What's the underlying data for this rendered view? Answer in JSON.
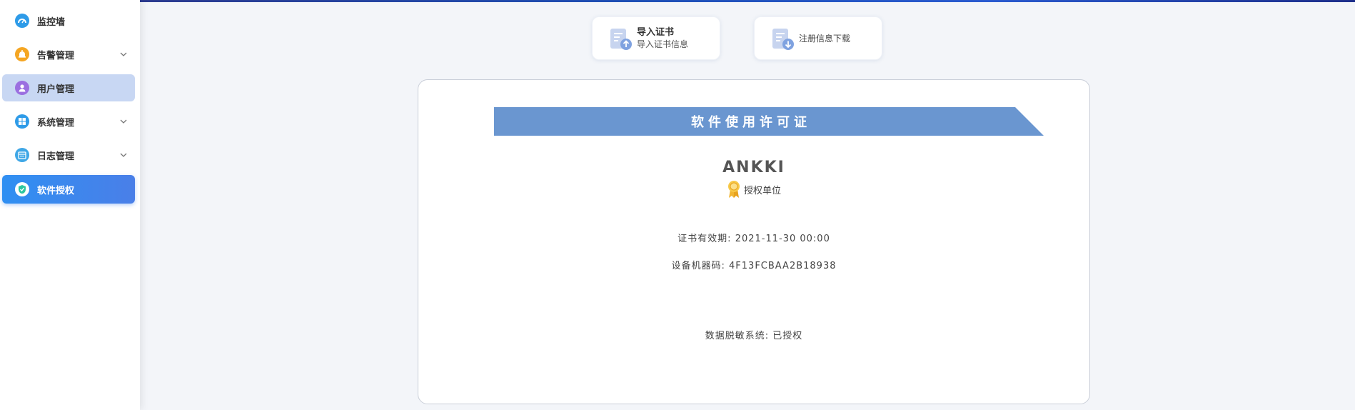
{
  "sidebar": {
    "items": [
      {
        "label": "监控墙",
        "icon": "dashboard-gauge-icon",
        "color": "#2e9be8"
      },
      {
        "label": "告警管理",
        "icon": "alarm-bell-icon",
        "color": "#f5a623"
      },
      {
        "label": "用户管理",
        "icon": "user-icon",
        "color": "#9b6fe0"
      },
      {
        "label": "系统管理",
        "icon": "windows-grid-icon",
        "color": "#2e9be8"
      },
      {
        "label": "日志管理",
        "icon": "log-calendar-icon",
        "color": "#3fa7e6"
      },
      {
        "label": "软件授权",
        "icon": "shield-check-icon",
        "color": "#2ec7a0"
      }
    ]
  },
  "actions": {
    "import": {
      "title": "导入证书",
      "subtitle": "导入证书信息"
    },
    "download": {
      "label": "注册信息下载"
    }
  },
  "certificate": {
    "title": "软件使用许可证",
    "company": "ANKKI",
    "unit_label": "授权单位",
    "validity_label": "证书有效期:",
    "validity_value": "2021-11-30 00:00",
    "machine_label": "设备机器码:",
    "machine_value": "4F13FCBAA2B18938",
    "system_label": "数据脱敏系统:",
    "system_value": "已授权"
  },
  "colors": {
    "active": "#2f8ff2",
    "selected_light": "#c8d7f3",
    "banner": "#6a96d0"
  }
}
